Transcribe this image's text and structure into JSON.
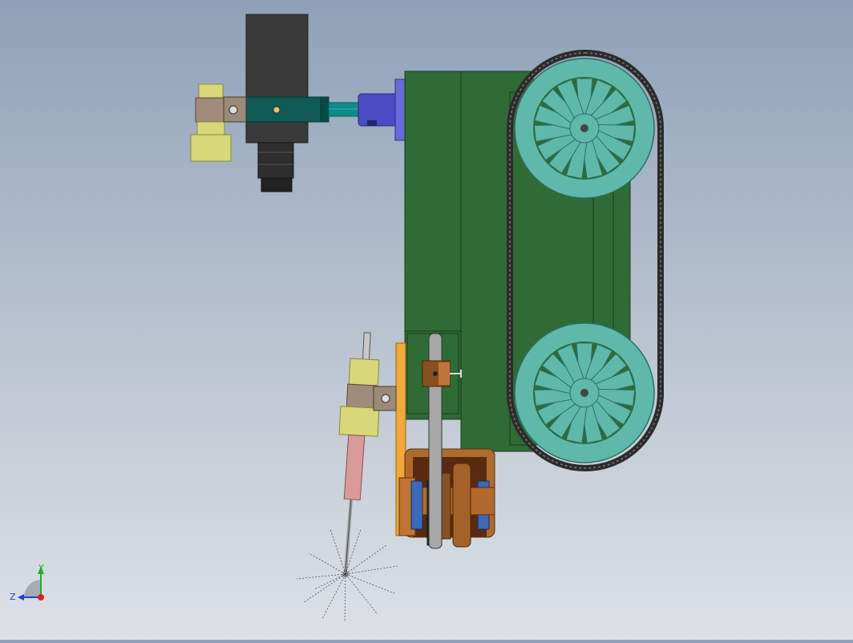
{
  "viewport": {
    "background_top": "#8fa1b8",
    "background_bottom": "#dde1e6"
  },
  "model": {
    "chassis_color": "#2f6b35",
    "wheel_color": "#5fb9aa",
    "track_color": "#2b2b2b",
    "clamp_color": "#d8d77a",
    "motor_color": "#3a3a3a",
    "coupling_color": "#4b4bc4",
    "copper_color": "#b06a2e",
    "torch_color": "#d99a9a"
  },
  "triad": {
    "x_label": "",
    "y_label": "Y",
    "z_label": "Z",
    "x_color": "#e02020",
    "y_color": "#20b020",
    "z_color": "#2040e0"
  }
}
